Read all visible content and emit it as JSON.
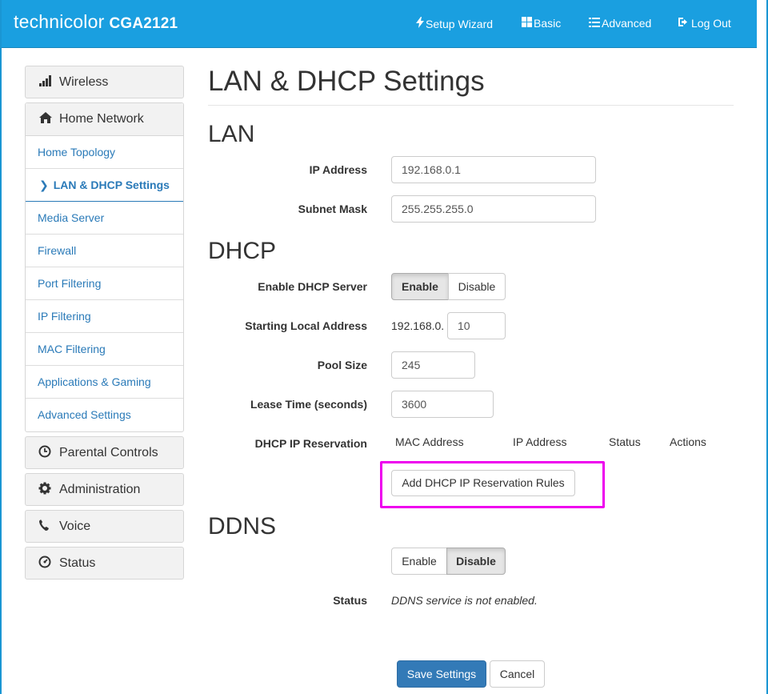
{
  "header": {
    "brand": "technicolor",
    "model": "CGA2121",
    "nav": [
      {
        "label": "Setup Wizard",
        "icon": "bolt-icon"
      },
      {
        "label": "Basic",
        "icon": "grid-icon"
      },
      {
        "label": "Advanced",
        "icon": "list-icon"
      },
      {
        "label": "Log Out",
        "icon": "logout-icon"
      }
    ]
  },
  "sidebar": {
    "wireless": "Wireless",
    "home_network": "Home Network",
    "home_items": [
      "Home Topology",
      "LAN & DHCP Settings",
      "Media Server",
      "Firewall",
      "Port Filtering",
      "IP Filtering",
      "MAC Filtering",
      "Applications & Gaming",
      "Advanced Settings"
    ],
    "parental": "Parental Controls",
    "administration": "Administration",
    "voice": "Voice",
    "status": "Status"
  },
  "main": {
    "title": "LAN & DHCP Settings",
    "lan": {
      "heading": "LAN",
      "ip_label": "IP Address",
      "ip_value": "192.168.0.1",
      "mask_label": "Subnet Mask",
      "mask_value": "255.255.255.0"
    },
    "dhcp": {
      "heading": "DHCP",
      "enable_label": "Enable DHCP Server",
      "enable_btn": "Enable",
      "disable_btn": "Disable",
      "start_label": "Starting Local Address",
      "start_prefix": "192.168.0.",
      "start_value": "10",
      "pool_label": "Pool Size",
      "pool_value": "245",
      "lease_label": "Lease Time (seconds)",
      "lease_value": "3600",
      "reservation_label": "DHCP IP Reservation",
      "columns": [
        "MAC Address",
        "IP Address",
        "Status",
        "Actions"
      ],
      "add_rules_btn": "Add DHCP IP Reservation Rules"
    },
    "ddns": {
      "heading": "DDNS",
      "enable_btn": "Enable",
      "disable_btn": "Disable",
      "status_label": "Status",
      "status_value": "DDNS service is not enabled."
    },
    "save_btn": "Save Settings",
    "cancel_btn": "Cancel"
  },
  "colors": {
    "header_bg": "#1a9fe0",
    "link": "#2a7ab8",
    "primary": "#337ab7",
    "highlight": "#ee00ee"
  }
}
